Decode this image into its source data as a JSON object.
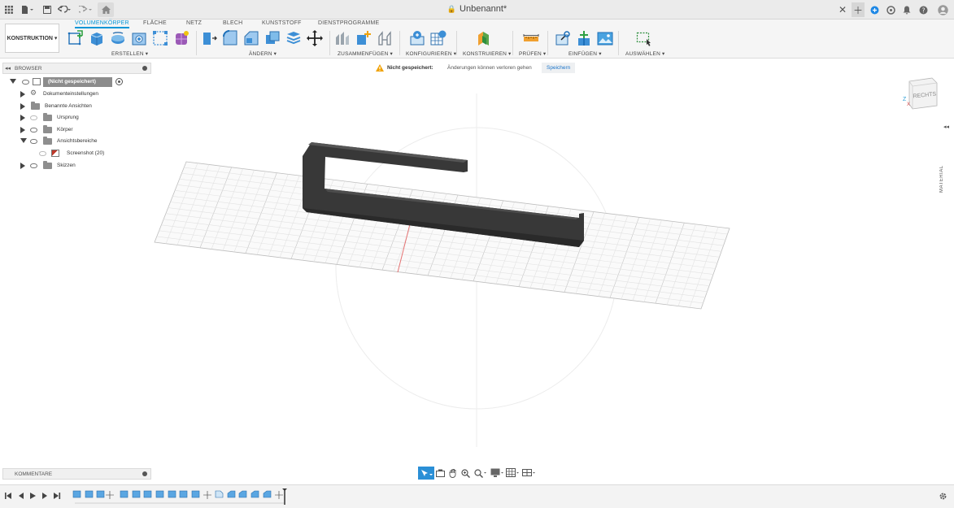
{
  "window": {
    "title": "Unbenannt*"
  },
  "workspace": {
    "label": "KONSTRUKTION",
    "caret": "▾"
  },
  "tabs": [
    {
      "label": "VOLUMENKÖRPER",
      "active": true
    },
    {
      "label": "FLÄCHE"
    },
    {
      "label": "NETZ"
    },
    {
      "label": "BLECH"
    },
    {
      "label": "KUNSTSTOFF"
    },
    {
      "label": "DIENSTPROGRAMME"
    }
  ],
  "ribbon_groups": [
    {
      "label": "ERSTELLEN ▾",
      "icons": [
        "create-sketch-icon",
        "extrude-icon",
        "revolve-icon",
        "hole-icon",
        "pattern-icon",
        "create-form-icon"
      ]
    },
    {
      "label": "ÄNDERN ▾",
      "icons": [
        "press-pull-icon",
        "fillet-icon",
        "chamfer-icon",
        "combine-icon",
        "shell-icon",
        "move-icon"
      ]
    },
    {
      "label": "ZUSAMMENFÜGEN ▾",
      "icons": [
        "joint-icon",
        "new-component-icon",
        "as-built-joint-icon"
      ]
    },
    {
      "label": "KONFIGURIEREN ▾",
      "icons": [
        "configure-icon",
        "configure-table-icon"
      ]
    },
    {
      "label": "KONSTRUIEREN ▾",
      "icons": [
        "construct-plane-icon"
      ]
    },
    {
      "label": "PRÜFEN ▾",
      "icons": [
        "measure-icon"
      ]
    },
    {
      "label": "EINFÜGEN ▾",
      "icons": [
        "insert-link-icon",
        "insert-mesh-icon",
        "insert-image-icon"
      ]
    },
    {
      "label": "AUSWÄHLEN ▾",
      "icons": [
        "select-icon"
      ]
    }
  ],
  "browser": {
    "header": "BROWSER",
    "root": "(Nicht gespeichert)",
    "items": [
      {
        "label": "Dokumenteinstellungen",
        "icon": "gear-icon"
      },
      {
        "label": "Benannte Ansichten",
        "icon": "folder-icon"
      },
      {
        "label": "Ursprung",
        "icon": "folder-icon"
      },
      {
        "label": "Körper",
        "icon": "folder-icon"
      },
      {
        "label": "Ansichtsbereiche",
        "icon": "folder-icon"
      },
      {
        "label": "Screenshot (20)",
        "icon": "image-icon"
      },
      {
        "label": "Skizzen",
        "icon": "folder-icon"
      }
    ]
  },
  "notice": {
    "title": "Nicht gespeichert:",
    "message": "Änderungen können verloren gehen",
    "action": "Speichern"
  },
  "viewcube": {
    "face": "RECHTS",
    "axis_z": "Z",
    "axis_x": "X"
  },
  "comments": {
    "label": "KOMMENTARE"
  },
  "side_panel": {
    "label": "MATERIAL"
  },
  "colors": {
    "accent": "#0696d7",
    "warning": "#f0a30a",
    "model": "#3a3a3a",
    "grid": "#c8c8c8"
  }
}
